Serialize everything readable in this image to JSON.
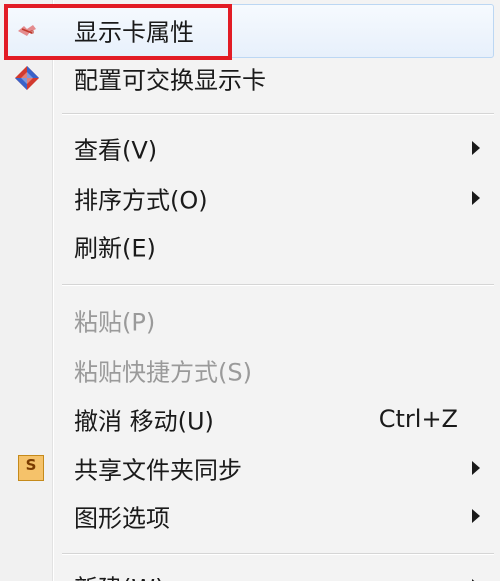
{
  "menu": {
    "items": [
      {
        "label": "显示卡属性",
        "icon": "graphics-card-icon"
      },
      {
        "label": "配置可交换显示卡",
        "icon": "switchable-graphics-icon"
      },
      {
        "label": "查看(V)",
        "submenu": true
      },
      {
        "label": "排序方式(O)",
        "submenu": true
      },
      {
        "label": "刷新(E)"
      },
      {
        "label": "粘贴(P)",
        "disabled": true
      },
      {
        "label": "粘贴快捷方式(S)",
        "disabled": true
      },
      {
        "label": "撤消 移动(U)",
        "shortcut": "Ctrl+Z"
      },
      {
        "label": "共享文件夹同步",
        "icon": "sync-folder-icon",
        "icon_text": "S",
        "submenu": true
      },
      {
        "label": "图形选项",
        "submenu": true
      },
      {
        "label": "新建(W)",
        "submenu": true
      }
    ]
  },
  "colors": {
    "highlight_border": "#bcd7f3",
    "red_frame": "#e21c25",
    "disabled_text": "#9a9a9a"
  }
}
